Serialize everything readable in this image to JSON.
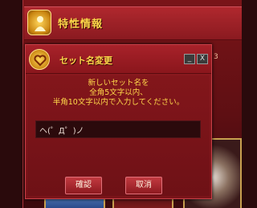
{
  "background": {
    "trait_header_title": "特性情報",
    "side_suffix": "3",
    "trait_icon": "person-sun-icon"
  },
  "dialog": {
    "title": "セット名変更",
    "title_icon": "heart-magnifier-icon",
    "minimize_label": "_",
    "close_label": "X",
    "instruction_line1": "新しいセット名を",
    "instruction_line2": "全角5文字以内、",
    "instruction_line3": "半角10文字以内で入力してください。",
    "input_value": "ヘ(゜Д゜)ノ",
    "confirm_label": "確認",
    "cancel_label": "取消"
  },
  "colors": {
    "accent_gold": "#ffd84a",
    "panel_red": "#8d1a20",
    "input_bg": "#2b0a0c"
  }
}
